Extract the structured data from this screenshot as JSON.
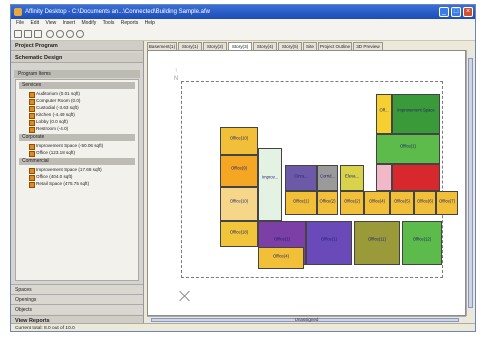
{
  "window": {
    "title": "Affinity Desktop - C:\\Documents an...\\Connected\\Building Sample.afw"
  },
  "menu": [
    "File",
    "Edit",
    "View",
    "Insert",
    "Modify",
    "Tools",
    "Reports",
    "Help"
  ],
  "left_panel": {
    "header": "Project Program",
    "schematic_header": "Schematic Design",
    "program_items_label": "Program Items",
    "categories": [
      {
        "name": "Services",
        "items": [
          "Auditorium  (0.01 sqft)",
          "Computer Room  (0.0)",
          "Custodial  (-3.63 sqft)",
          "Kitchen  (-4.49 sqft)",
          "Lobby  (0.0 sqft)",
          "Restroom  (-4.0)"
        ]
      },
      {
        "name": "Corporate",
        "items": [
          "Improvement Space  (-50.06 sqft)",
          "Office  (123.18 sqft)"
        ]
      },
      {
        "name": "Commercial",
        "items": [
          "Improvement Space  (17.68 sqft)",
          "Office  (404.0 sqft)",
          "Retail Space  (475.75 sqft)"
        ]
      }
    ],
    "footer_items": [
      "Spaces",
      "Openings",
      "Objects"
    ],
    "view_reports": "View Reports"
  },
  "tabs": [
    "Basement(1)",
    "Story(1)",
    "Story(2)",
    "Story(3)",
    "Story(4)",
    "Story(5)",
    "Site",
    "Project Outline",
    "3D Preview"
  ],
  "active_tab": "Story(3)",
  "floor_plan": {
    "rooms": [
      {
        "label": "Office(10)",
        "color": "#f2c038"
      },
      {
        "label": "Office(9)",
        "color": "#f5a623"
      },
      {
        "label": "Improv...",
        "color": "#e4f2e4"
      },
      {
        "label": "Office(10)",
        "color": "#f6d78a"
      },
      {
        "label": "Office(18)",
        "color": "#f0c53a"
      },
      {
        "label": "Office(1)",
        "color": "#7b3fa6"
      },
      {
        "label": "Circu...",
        "color": "#6c5aa8"
      },
      {
        "label": "Corrid...",
        "color": "#9a9a9a"
      },
      {
        "label": "Eleva...",
        "color": "#d8d34a"
      },
      {
        "label": "Office(1)",
        "color": "#f2c038"
      },
      {
        "label": "Office(2)",
        "color": "#f2c038"
      },
      {
        "label": "Office(2)",
        "color": "#f2c038"
      },
      {
        "label": "Office(4)",
        "color": "#f2c038"
      },
      {
        "label": "Office(5)",
        "color": "#f2c038"
      },
      {
        "label": "Office(6)",
        "color": "#f2c038"
      },
      {
        "label": "Office(7)",
        "color": "#f2c038"
      },
      {
        "label": "Office(8)",
        "color": "#f2c038"
      },
      {
        "label": "Off...",
        "color": "#f6d030"
      },
      {
        "label": "Improvement Space",
        "color": "#3a9a3a"
      },
      {
        "label": "Office(1)",
        "color": "#5cbb4a"
      },
      {
        "label": "",
        "color": "#d7282e"
      },
      {
        "label": "",
        "color": "#f0b8c8"
      },
      {
        "label": "Office(4)",
        "color": "#f2c038"
      },
      {
        "label": "Office(1)",
        "color": "#6a4ab8"
      },
      {
        "label": "Office(11)",
        "color": "#9a9a3a"
      },
      {
        "label": "Office(12)",
        "color": "#5cbb4a"
      },
      {
        "label": "Office(9)",
        "color": "#6a7ac8"
      }
    ]
  },
  "scrollbar_label": "Unassigned",
  "status": "Current total: 8.0 out of 10.0"
}
